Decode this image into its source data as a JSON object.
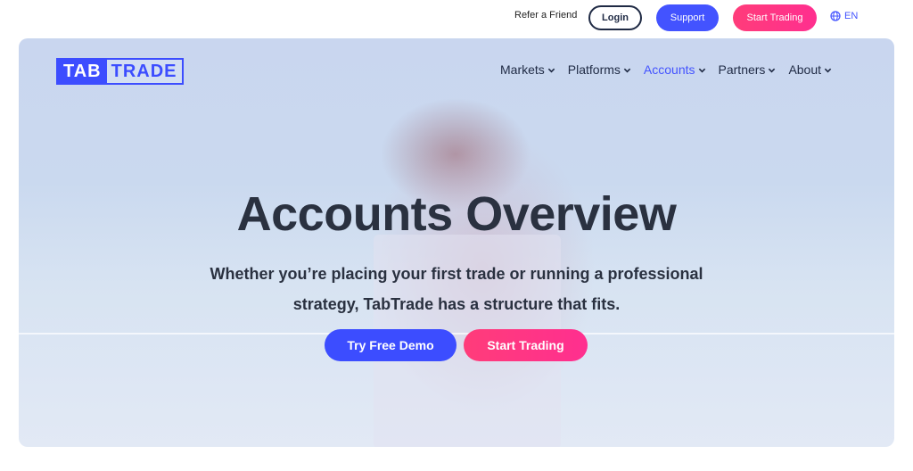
{
  "topbar": {
    "refer_label": "Refer a Friend",
    "login_label": "Login",
    "support_label": "Support",
    "start_trading_label": "Start Trading",
    "language": "EN"
  },
  "logo": {
    "part1": "TAB",
    "part2": "TRADE"
  },
  "nav": {
    "items": [
      {
        "label": "Markets"
      },
      {
        "label": "Platforms"
      },
      {
        "label": "Accounts"
      },
      {
        "label": "Partners"
      },
      {
        "label": "About"
      }
    ],
    "active": "Accounts"
  },
  "hero": {
    "title": "Accounts Overview",
    "subtitle_line1": "Whether you’re placing your first trade or running a professional",
    "subtitle_line2": "strategy, TabTrade has a structure that fits.",
    "demo_label": "Try Free Demo",
    "start_label": "Start Trading"
  },
  "colors": {
    "accent": "#4353ff",
    "pink": "#ff3c7a",
    "text_dark": "#2a3140"
  }
}
